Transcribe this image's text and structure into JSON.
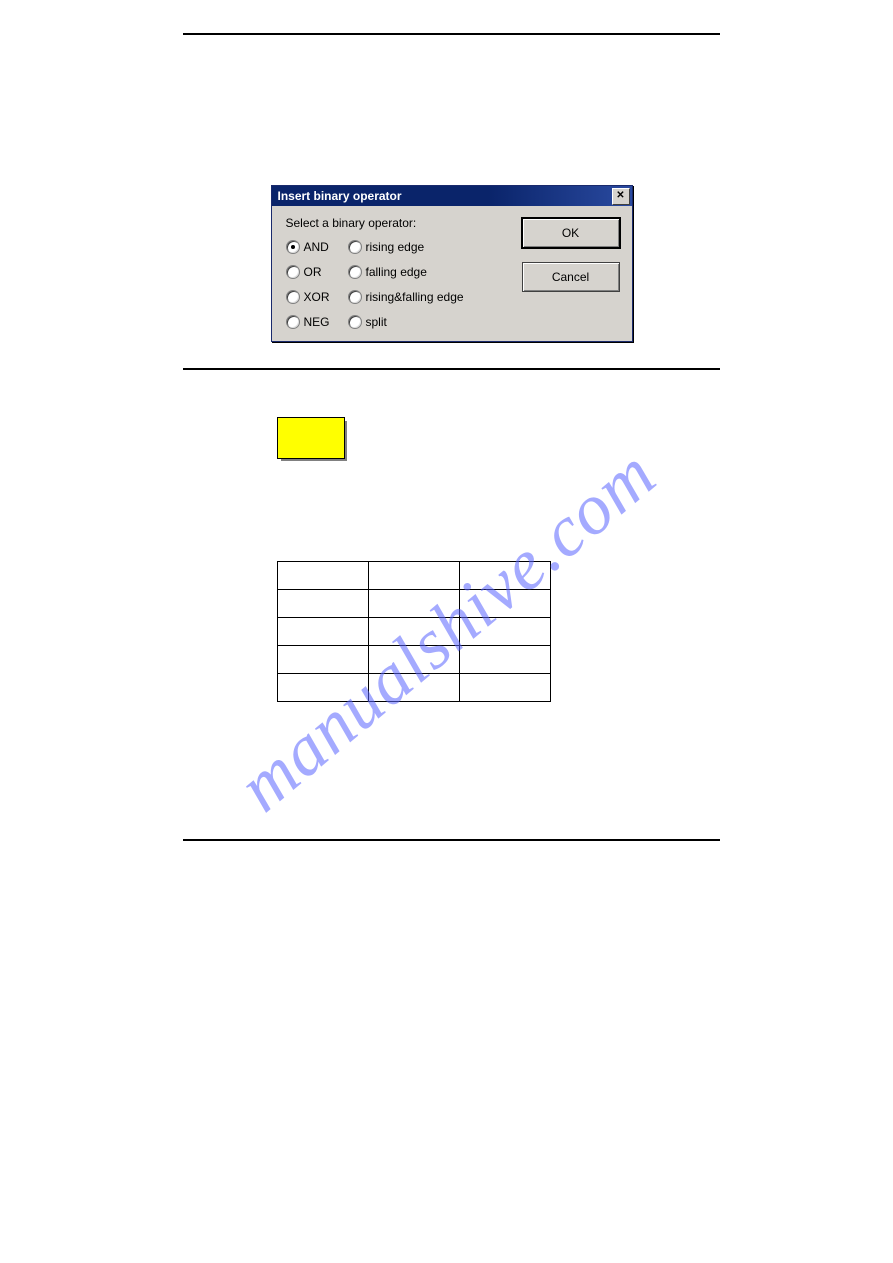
{
  "dialog": {
    "title": "Insert binary operator",
    "prompt": "Select a binary operator:",
    "options": {
      "and": "AND",
      "or": "OR",
      "xor": "XOR",
      "neg": "NEG",
      "rising": "rising edge",
      "falling": "falling edge",
      "risingfalling": "rising&falling edge",
      "split": "split"
    },
    "selected": "and",
    "buttons": {
      "ok": "OK",
      "cancel": "Cancel"
    },
    "close_glyph": "✕"
  },
  "swatch_color": "#ffff00",
  "chart_data": {
    "type": "table",
    "title": "",
    "rows": 5,
    "cols": 3,
    "cells": [
      [
        "",
        "",
        ""
      ],
      [
        "",
        "",
        ""
      ],
      [
        "",
        "",
        ""
      ],
      [
        "",
        "",
        ""
      ],
      [
        "",
        "",
        ""
      ]
    ]
  },
  "watermark": "manualshive.com"
}
